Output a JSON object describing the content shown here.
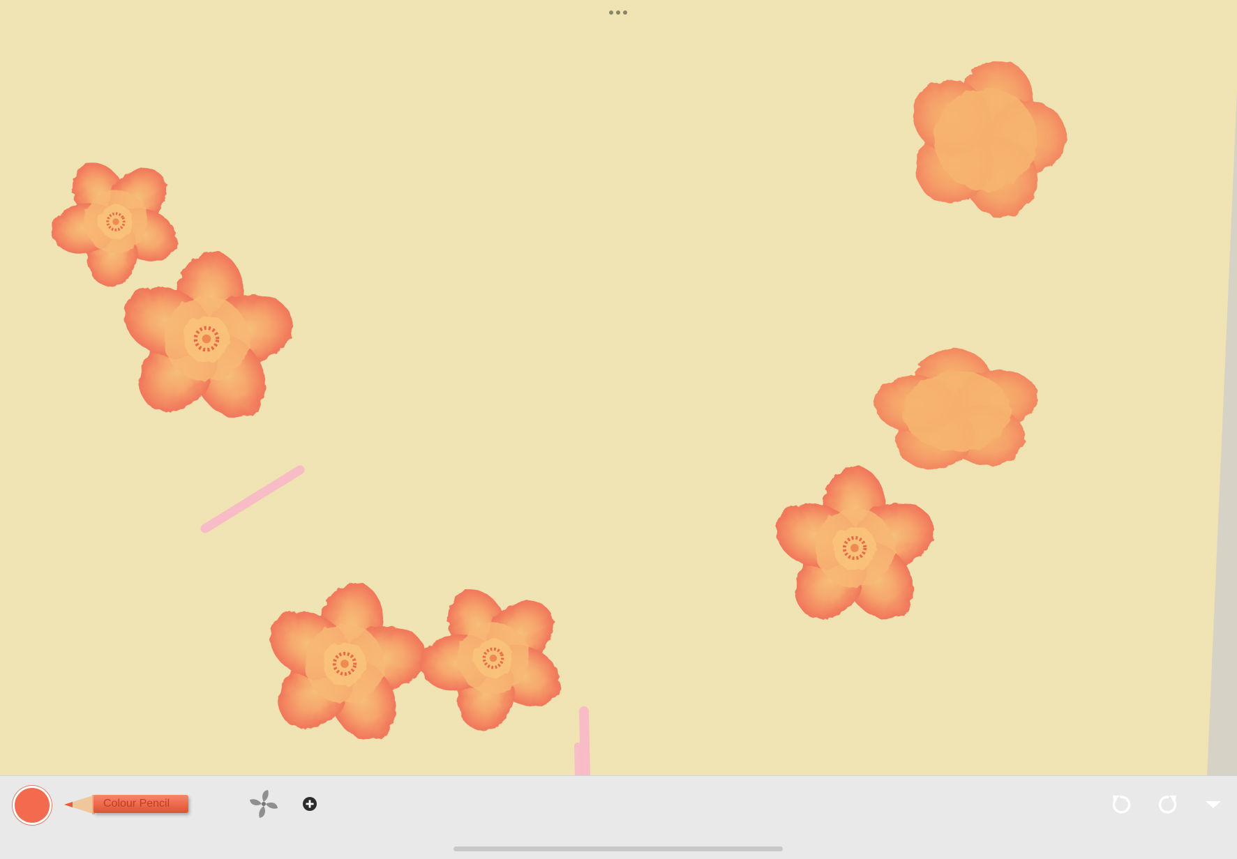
{
  "canvas": {
    "more_menu_icon": "ellipsis-icon",
    "paper_color": "#f2e5b4",
    "strokes": [
      {
        "kind": "flower",
        "colors": [
          "#f2785c",
          "#f6b46b",
          "#ea5a3c"
        ]
      },
      {
        "kind": "pink-mark",
        "color": "#f7b9c6"
      }
    ]
  },
  "toolbar": {
    "current_color": "#f36a4f",
    "tool_label": "Colour Pencil",
    "brush_options_icon": "fan-icon",
    "add_icon": "plus-circle-icon",
    "undo_icon": "undo-icon",
    "redo_icon": "redo-icon",
    "collapse_icon": "chevron-down-icon"
  }
}
